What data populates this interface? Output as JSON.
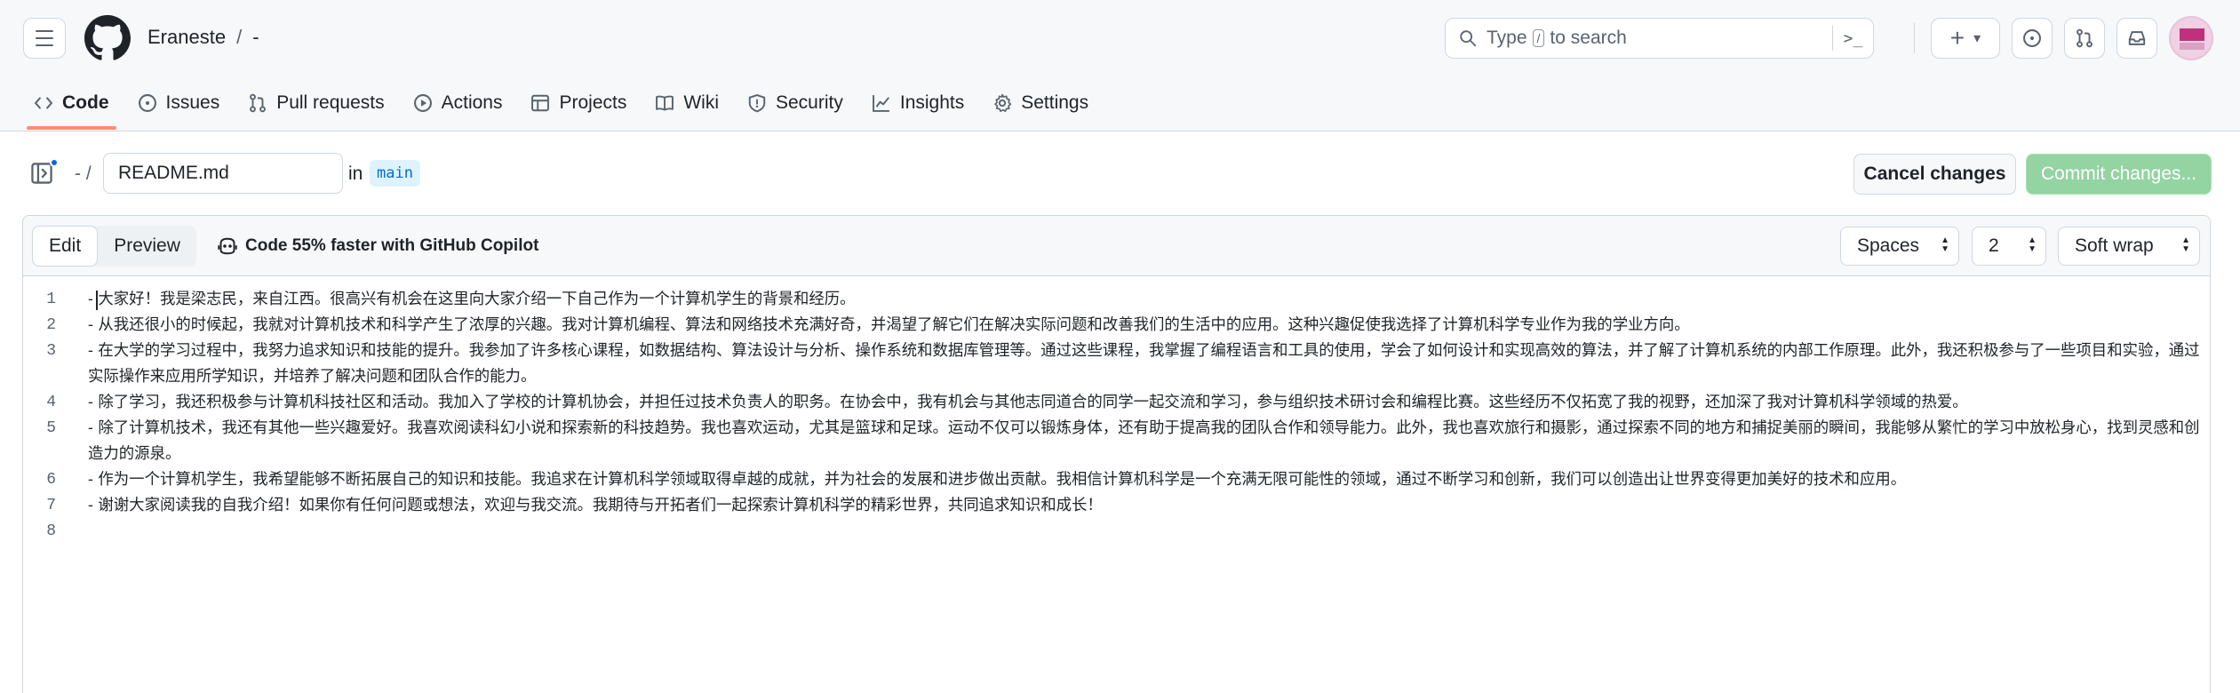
{
  "header": {
    "owner": "Eraneste",
    "separator": "/",
    "repo": "-",
    "search": {
      "pre": "Type",
      "key": "/",
      "post": "to search",
      "cmd_glyph": ">_"
    },
    "new_glyph": "+",
    "new_caret": "▾"
  },
  "nav": {
    "tabs": [
      {
        "label": "Code",
        "icon": "code-icon",
        "active": true
      },
      {
        "label": "Issues",
        "icon": "issue-circle-icon"
      },
      {
        "label": "Pull requests",
        "icon": "pull-request-icon"
      },
      {
        "label": "Actions",
        "icon": "play-icon"
      },
      {
        "label": "Projects",
        "icon": "table-icon"
      },
      {
        "label": "Wiki",
        "icon": "book-icon"
      },
      {
        "label": "Security",
        "icon": "shield-icon"
      },
      {
        "label": "Insights",
        "icon": "graph-icon"
      },
      {
        "label": "Settings",
        "icon": "gear-icon"
      }
    ]
  },
  "breadcrumb": {
    "repo_part": "- /",
    "filename": "README.md",
    "in_label": "in",
    "branch": "main",
    "cancel_label": "Cancel changes",
    "commit_label": "Commit changes..."
  },
  "editor": {
    "edit_label": "Edit",
    "preview_label": "Preview",
    "copilot_label": "Code 55% faster with GitHub Copilot",
    "indent_mode": "Spaces",
    "indent_size": "2",
    "wrap_mode": "Soft wrap",
    "lines": [
      {
        "n": "1",
        "text": "- 大家好！我是梁志民，来自江西。很高兴有机会在这里向大家介绍一下自己作为一个计算机学生的背景和经历。"
      },
      {
        "n": "2",
        "text": "- 从我还很小的时候起，我就对计算机技术和科学产生了浓厚的兴趣。我对计算机编程、算法和网络技术充满好奇，并渴望了解它们在解决实际问题和改善我们的生活中的应用。这种兴趣促使我选择了计算机科学专业作为我的学业方向。"
      },
      {
        "n": "3",
        "text": "- 在大学的学习过程中，我努力追求知识和技能的提升。我参加了许多核心课程，如数据结构、算法设计与分析、操作系统和数据库管理等。通过这些课程，我掌握了编程语言和工具的使用，学会了如何设计和实现高效的算法，并了解了计算机系统的内部工作原理。此外，我还积极参与了一些项目和实验，通过实际操作来应用所学知识，并培养了解决问题和团队合作的能力。"
      },
      {
        "n": "4",
        "text": "- 除了学习，我还积极参与计算机科技社区和活动。我加入了学校的计算机协会，并担任过技术负责人的职务。在协会中，我有机会与其他志同道合的同学一起交流和学习，参与组织技术研讨会和编程比赛。这些经历不仅拓宽了我的视野，还加深了我对计算机科学领域的热爱。"
      },
      {
        "n": "5",
        "text": "- 除了计算机技术，我还有其他一些兴趣爱好。我喜欢阅读科幻小说和探索新的科技趋势。我也喜欢运动，尤其是篮球和足球。运动不仅可以锻炼身体，还有助于提高我的团队合作和领导能力。此外，我也喜欢旅行和摄影，通过探索不同的地方和捕捉美丽的瞬间，我能够从繁忙的学习中放松身心，找到灵感和创造力的源泉。"
      },
      {
        "n": "6",
        "text": "- 作为一个计算机学生，我希望能够不断拓展自己的知识和技能。我追求在计算机科学领域取得卓越的成就，并为社会的发展和进步做出贡献。我相信计算机科学是一个充满无限可能性的领域，通过不断学习和创新，我们可以创造出让世界变得更加美好的技术和应用。"
      },
      {
        "n": "7",
        "text": "- 谢谢大家阅读我的自我介绍！如果你有任何问题或想法，欢迎与我交流。我期待与开拓者们一起探索计算机科学的精彩世界，共同追求知识和成长！"
      },
      {
        "n": "8",
        "text": ""
      }
    ]
  }
}
